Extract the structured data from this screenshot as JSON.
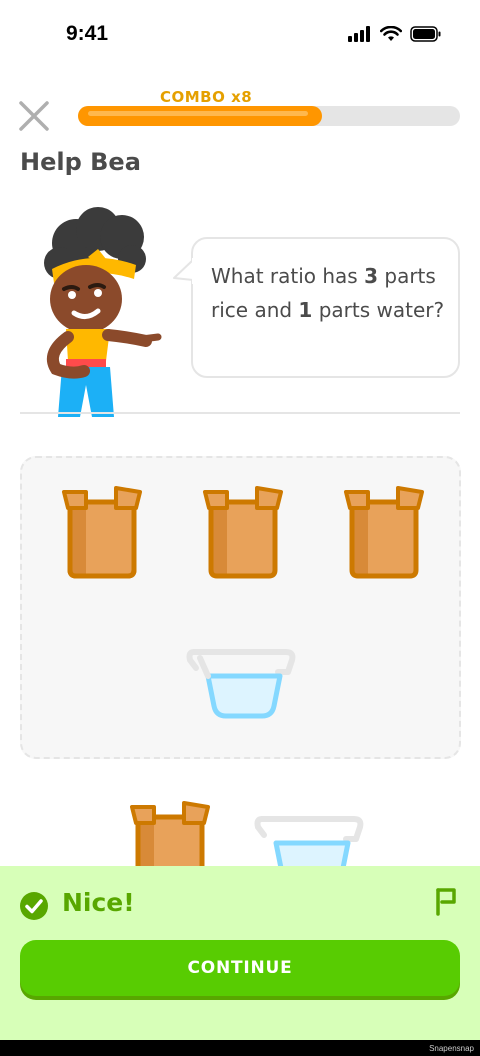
{
  "status_bar": {
    "time": "9:41"
  },
  "progress": {
    "combo_label": "COMBO x8",
    "fraction": 0.64
  },
  "header": {
    "title": "Help Bea"
  },
  "prompt": {
    "part1": "What ratio has ",
    "rice_count": "3",
    "part2": " parts rice and ",
    "water_count": "1",
    "part3": " parts water?"
  },
  "answer_area": {
    "items": [
      "rice-box",
      "rice-box",
      "rice-box",
      "water-cup"
    ]
  },
  "word_bank": {
    "items": [
      "rice-box",
      "water-cup"
    ]
  },
  "feedback": {
    "message": "Nice!",
    "button_label": "CONTINUE"
  },
  "footer": {
    "watermark": "Snapensnap"
  },
  "colors": {
    "accent_green": "#58cc02",
    "feedback_bg": "#d7ffb8",
    "feedback_text": "#58a700",
    "progress_orange": "#ff9600",
    "box_orange": "#cd7900"
  }
}
